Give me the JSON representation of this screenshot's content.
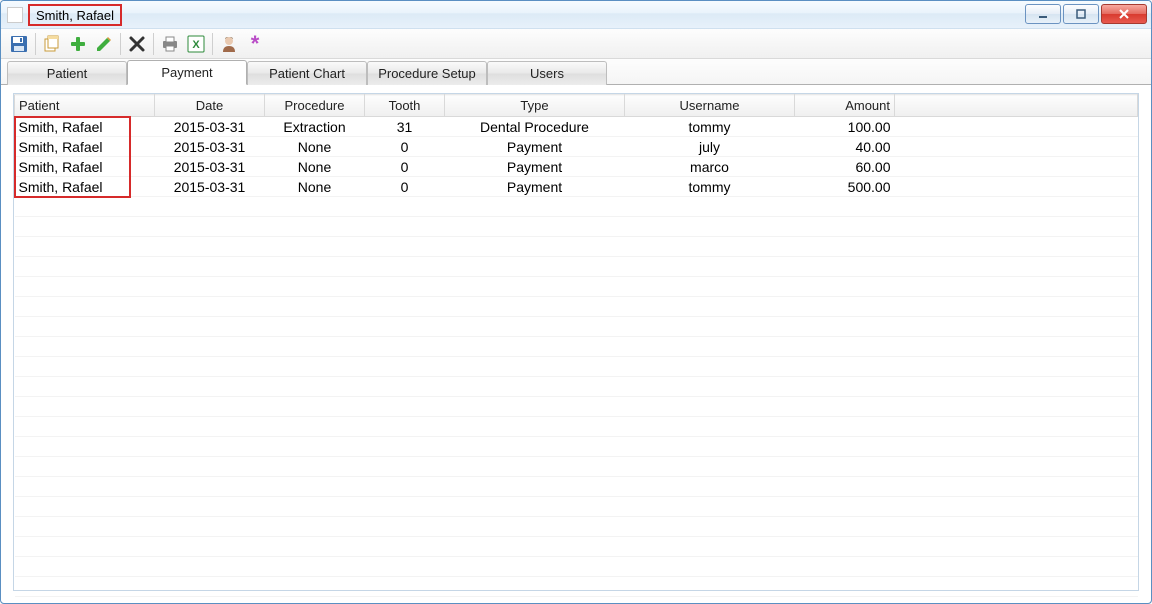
{
  "window": {
    "title": "Smith, Rafael"
  },
  "toolbar": {
    "icons": {
      "save": "save-icon",
      "copy": "copy-icon",
      "add": "plus-icon",
      "edit": "pencil-icon",
      "delete": "x-icon",
      "print": "printer-icon",
      "excel": "excel-icon",
      "user": "user-icon",
      "asterisk": "asterisk-icon"
    }
  },
  "tabs": {
    "items": [
      {
        "label": "Patient",
        "active": false
      },
      {
        "label": "Payment",
        "active": true
      },
      {
        "label": "Patient Chart",
        "active": false
      },
      {
        "label": "Procedure Setup",
        "active": false
      },
      {
        "label": "Users",
        "active": false
      }
    ]
  },
  "grid": {
    "headers": {
      "patient": "Patient",
      "date": "Date",
      "procedure": "Procedure",
      "tooth": "Tooth",
      "type": "Type",
      "username": "Username",
      "amount": "Amount"
    },
    "rows": [
      {
        "patient": "Smith, Rafael",
        "date": "2015-03-31",
        "procedure": "Extraction",
        "tooth": "31",
        "type": "Dental Procedure",
        "username": "tommy",
        "amount": "100.00"
      },
      {
        "patient": "Smith, Rafael",
        "date": "2015-03-31",
        "procedure": "None",
        "tooth": "0",
        "type": "Payment",
        "username": "july",
        "amount": "40.00"
      },
      {
        "patient": "Smith, Rafael",
        "date": "2015-03-31",
        "procedure": "None",
        "tooth": "0",
        "type": "Payment",
        "username": "marco",
        "amount": "60.00"
      },
      {
        "patient": "Smith, Rafael",
        "date": "2015-03-31",
        "procedure": "None",
        "tooth": "0",
        "type": "Payment",
        "username": "tommy",
        "amount": "500.00"
      }
    ]
  }
}
